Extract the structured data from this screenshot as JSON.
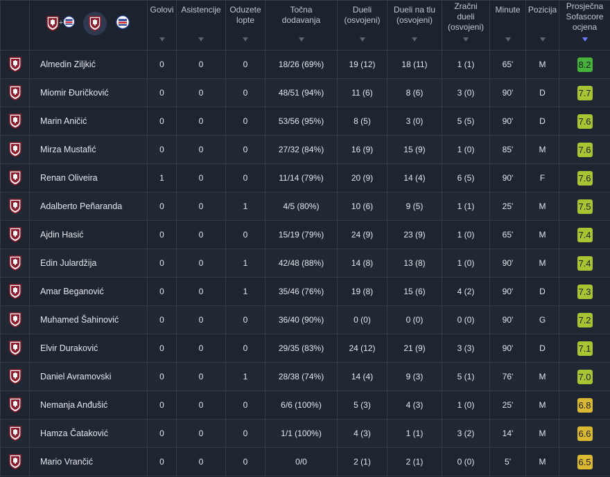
{
  "colors": {
    "rating_green": "#45b23c",
    "rating_lime": "#a9c433",
    "rating_yellow": "#d9b832",
    "sarajevo_red": "#8e1b2b",
    "zeljeznicar_blue": "#1f3b95"
  },
  "header": {
    "goals": "Golovi",
    "assists": "Asistencije",
    "tackles": [
      "Oduzete",
      "lopte"
    ],
    "passes": [
      "Točna",
      "dodavanja"
    ],
    "duels": [
      "Dueli",
      "(osvojeni)"
    ],
    "ground_duels": [
      "Dueli na tlu",
      "(osvojeni)"
    ],
    "aerial_duels": [
      "Zračni",
      "dueli",
      "(osvojeni)"
    ],
    "minutes": "Minute",
    "position": "Pozicija",
    "rating": [
      "Prosječna",
      "Sofascore",
      "ocjena"
    ],
    "plus": "+"
  },
  "players": [
    {
      "name": "Almedin Ziljkić",
      "goals": "0",
      "assists": "0",
      "tackles": "0",
      "passes": "18/26 (69%)",
      "duels": "19 (12)",
      "ground": "18 (11)",
      "aerial": "1 (1)",
      "minutes": "65'",
      "pos": "M",
      "rating": "8.2",
      "tone": "green"
    },
    {
      "name": "Miomir Đuričković",
      "goals": "0",
      "assists": "0",
      "tackles": "0",
      "passes": "48/51 (94%)",
      "duels": "11 (6)",
      "ground": "8 (6)",
      "aerial": "3 (0)",
      "minutes": "90'",
      "pos": "D",
      "rating": "7.7",
      "tone": "lime"
    },
    {
      "name": "Marin Aničić",
      "goals": "0",
      "assists": "0",
      "tackles": "0",
      "passes": "53/56 (95%)",
      "duels": "8 (5)",
      "ground": "3 (0)",
      "aerial": "5 (5)",
      "minutes": "90'",
      "pos": "D",
      "rating": "7.6",
      "tone": "lime"
    },
    {
      "name": "Mirza Mustafić",
      "goals": "0",
      "assists": "0",
      "tackles": "0",
      "passes": "27/32 (84%)",
      "duels": "16 (9)",
      "ground": "15 (9)",
      "aerial": "1 (0)",
      "minutes": "85'",
      "pos": "M",
      "rating": "7.6",
      "tone": "lime"
    },
    {
      "name": "Renan Oliveira",
      "goals": "1",
      "assists": "0",
      "tackles": "0",
      "passes": "11/14 (79%)",
      "duels": "20 (9)",
      "ground": "14 (4)",
      "aerial": "6 (5)",
      "minutes": "90'",
      "pos": "F",
      "rating": "7.6",
      "tone": "lime"
    },
    {
      "name": "Adalberto Peñaranda",
      "goals": "0",
      "assists": "0",
      "tackles": "1",
      "passes": "4/5 (80%)",
      "duels": "10 (6)",
      "ground": "9 (5)",
      "aerial": "1 (1)",
      "minutes": "25'",
      "pos": "M",
      "rating": "7.5",
      "tone": "lime"
    },
    {
      "name": "Ajdin Hasić",
      "goals": "0",
      "assists": "0",
      "tackles": "0",
      "passes": "15/19 (79%)",
      "duels": "24 (9)",
      "ground": "23 (9)",
      "aerial": "1 (0)",
      "minutes": "65'",
      "pos": "M",
      "rating": "7.4",
      "tone": "lime"
    },
    {
      "name": "Edin Julardžija",
      "goals": "0",
      "assists": "0",
      "tackles": "1",
      "passes": "42/48 (88%)",
      "duels": "14 (8)",
      "ground": "13 (8)",
      "aerial": "1 (0)",
      "minutes": "90'",
      "pos": "M",
      "rating": "7.4",
      "tone": "lime"
    },
    {
      "name": "Amar Beganović",
      "goals": "0",
      "assists": "0",
      "tackles": "1",
      "passes": "35/46 (76%)",
      "duels": "19 (8)",
      "ground": "15 (6)",
      "aerial": "4 (2)",
      "minutes": "90'",
      "pos": "D",
      "rating": "7.3",
      "tone": "lime"
    },
    {
      "name": "Muhamed Šahinović",
      "goals": "0",
      "assists": "0",
      "tackles": "0",
      "passes": "36/40 (90%)",
      "duels": "0 (0)",
      "ground": "0 (0)",
      "aerial": "0 (0)",
      "minutes": "90'",
      "pos": "G",
      "rating": "7.2",
      "tone": "lime"
    },
    {
      "name": "Elvir Duraković",
      "goals": "0",
      "assists": "0",
      "tackles": "0",
      "passes": "29/35 (83%)",
      "duels": "24 (12)",
      "ground": "21 (9)",
      "aerial": "3 (3)",
      "minutes": "90'",
      "pos": "D",
      "rating": "7.1",
      "tone": "lime"
    },
    {
      "name": "Daniel Avramovski",
      "goals": "0",
      "assists": "0",
      "tackles": "1",
      "passes": "28/38 (74%)",
      "duels": "14 (4)",
      "ground": "9 (3)",
      "aerial": "5 (1)",
      "minutes": "76'",
      "pos": "M",
      "rating": "7.0",
      "tone": "lime"
    },
    {
      "name": "Nemanja Anđušić",
      "goals": "0",
      "assists": "0",
      "tackles": "0",
      "passes": "6/6 (100%)",
      "duels": "5 (3)",
      "ground": "4 (3)",
      "aerial": "1 (0)",
      "minutes": "25'",
      "pos": "M",
      "rating": "6.8",
      "tone": "yellow"
    },
    {
      "name": "Hamza Čataković",
      "goals": "0",
      "assists": "0",
      "tackles": "0",
      "passes": "1/1 (100%)",
      "duels": "4 (3)",
      "ground": "1 (1)",
      "aerial": "3 (2)",
      "minutes": "14'",
      "pos": "M",
      "rating": "6.6",
      "tone": "yellow"
    },
    {
      "name": "Mario Vrančić",
      "goals": "0",
      "assists": "0",
      "tackles": "0",
      "passes": "0/0",
      "duels": "2 (1)",
      "ground": "2 (1)",
      "aerial": "0 (0)",
      "minutes": "5'",
      "pos": "M",
      "rating": "6.5",
      "tone": "yellow"
    }
  ]
}
